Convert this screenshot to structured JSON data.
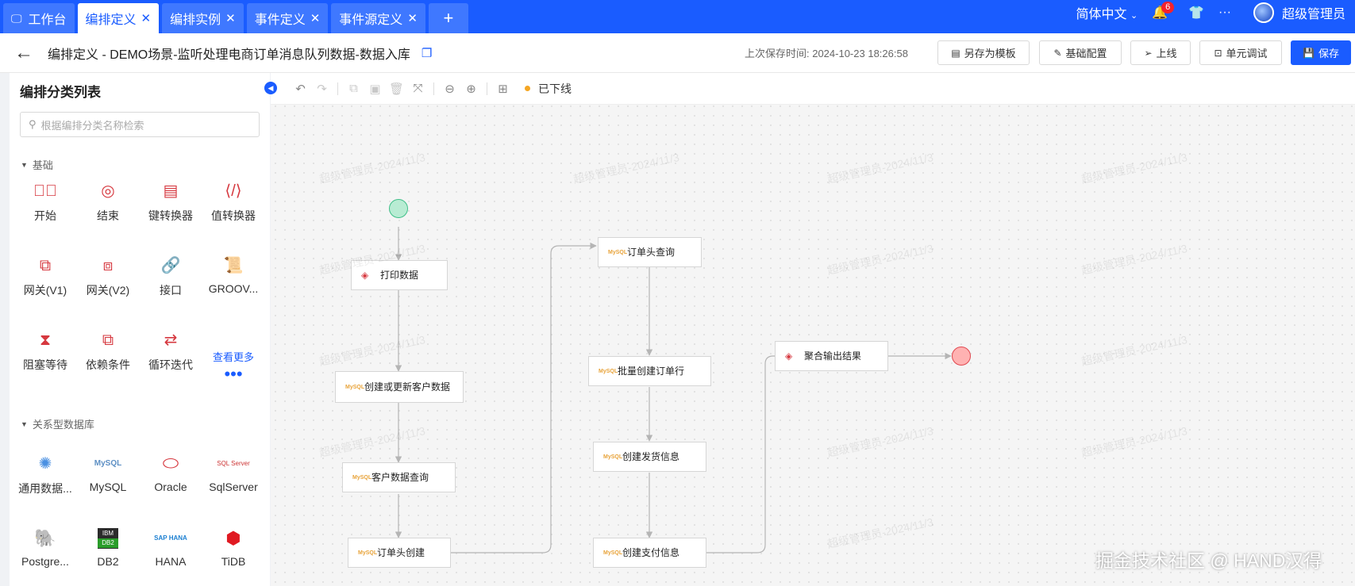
{
  "tabs": [
    {
      "label": "工作台",
      "icon": "monitor-icon",
      "active": false,
      "closable": false
    },
    {
      "label": "编排定义",
      "active": true,
      "closable": true
    },
    {
      "label": "编排实例",
      "active": false,
      "closable": true
    },
    {
      "label": "事件定义",
      "active": false,
      "closable": true
    },
    {
      "label": "事件源定义",
      "active": false,
      "closable": true
    }
  ],
  "tab_close": "✕",
  "tab_add": "+",
  "topbar": {
    "language": "简体中文",
    "notification_count": "6",
    "more": "···",
    "user": "超级管理员"
  },
  "header": {
    "back": "←",
    "title": "编排定义 - DEMO场景-监听处理电商订单消息队列数据-数据入库",
    "save_time": "上次保存时间:  2024-10-23 18:26:58",
    "buttons": {
      "save_as_template": "另存为模板",
      "basic_config": "基础配置",
      "online": "上线",
      "unit_test": "单元调试",
      "save": "保存"
    }
  },
  "sidebar": {
    "title": "编排分类列表",
    "search_placeholder": "根据编排分类名称检索",
    "section_basic": "基础",
    "section_db": "关系型数据库",
    "basic_tools": [
      {
        "label": "开始",
        "icon": "play-circle-icon"
      },
      {
        "label": "结束",
        "icon": "stop-circle-icon"
      },
      {
        "label": "键转换器",
        "icon": "key-converter-icon"
      },
      {
        "label": "值转换器",
        "icon": "code-icon"
      },
      {
        "label": "网关(V1)",
        "icon": "gateway-v1-icon"
      },
      {
        "label": "网关(V2)",
        "icon": "gateway-v2-icon"
      },
      {
        "label": "接口",
        "icon": "link-icon"
      },
      {
        "label": "GROOV...",
        "icon": "script-icon"
      },
      {
        "label": "阻塞等待",
        "icon": "hourglass-icon"
      },
      {
        "label": "依赖条件",
        "icon": "dependency-icon"
      },
      {
        "label": "循环迭代",
        "icon": "loop-icon"
      }
    ],
    "more": {
      "label": "查看更多",
      "icon": "•••"
    },
    "db_tools": [
      {
        "label": "通用数据...",
        "icon": "generic-db-icon"
      },
      {
        "label": "MySQL",
        "icon": "mysql-icon"
      },
      {
        "label": "Oracle",
        "icon": "oracle-icon"
      },
      {
        "label": "SqlServer",
        "icon": "sqlserver-icon"
      },
      {
        "label": "Postgre...",
        "icon": "postgresql-icon"
      },
      {
        "label": "DB2",
        "icon": "db2-icon"
      },
      {
        "label": "HANA",
        "icon": "hana-icon"
      },
      {
        "label": "TiDB",
        "icon": "tidb-icon"
      }
    ],
    "db_icon_text": {
      "db2_top": "IBM",
      "db2_bottom": "DB2",
      "hana": "SAP HANA",
      "mysql": "MySQL",
      "sqlserver": "SQL Server"
    }
  },
  "canvas": {
    "status": "已下线",
    "status_color": "#f5a623",
    "nodes": [
      {
        "label": "打印数据",
        "icon": "print-data-icon"
      },
      {
        "label": "创建或更新客户数据",
        "icon": "mysql-icon"
      },
      {
        "label": "客户数据查询",
        "icon": "mysql-icon"
      },
      {
        "label": "订单头创建",
        "icon": "mysql-icon"
      },
      {
        "label": "订单头查询",
        "icon": "mysql-icon"
      },
      {
        "label": "批量创建订单行",
        "icon": "mysql-icon"
      },
      {
        "label": "创建发货信息",
        "icon": "mysql-icon"
      },
      {
        "label": "创建支付信息",
        "icon": "mysql-icon"
      },
      {
        "label": "聚合输出结果",
        "icon": "print-data-icon"
      }
    ],
    "node_icon_text": "MySQL",
    "watermark": "超级管理员-2024/11/3"
  },
  "footer_watermark": "掘金技术社区 @ HAND汉得",
  "colors": {
    "primary": "#1a5cff",
    "node_icon": "#d6383f",
    "start": "#3fbf88",
    "end": "#e0474f"
  }
}
